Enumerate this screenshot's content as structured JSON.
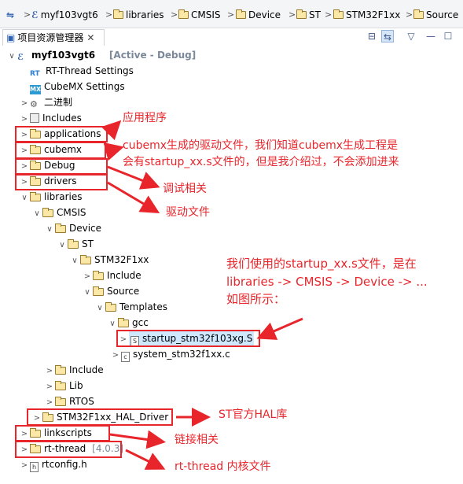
{
  "breadcrumb": [
    "myf103vgt6",
    "libraries",
    "CMSIS",
    "Device",
    "ST",
    "STM32F1xx",
    "Source"
  ],
  "view": {
    "tab_label": "项目资源管理器",
    "close_glyph": "✕"
  },
  "toolbar": {
    "collapse": "⊟",
    "link": "⇆",
    "menu": "▽",
    "minimize": "—",
    "maximize": "☐"
  },
  "tree": {
    "project": "myf103vgt6",
    "project_status": "[Active - Debug]",
    "rt_settings": "RT-Thread Settings",
    "cubemx_settings": "CubeMX Settings",
    "binaries": "二进制",
    "includes": "Includes",
    "applications": "applications",
    "cubemx": "cubemx",
    "debug": "Debug",
    "drivers": "drivers",
    "libraries": "libraries",
    "cmsis": "CMSIS",
    "device": "Device",
    "st": "ST",
    "stm32f1xx": "STM32F1xx",
    "include": "Include",
    "source": "Source",
    "templates": "Templates",
    "gcc": "gcc",
    "startup_file": "startup_stm32f103xg.S",
    "system_file": "system_stm32f1xx.c",
    "cmsis_include": "Include",
    "cmsis_lib": "Lib",
    "cmsis_rtos": "RTOS",
    "hal_driver": "STM32F1xx_HAL_Driver",
    "linkscripts": "linkscripts",
    "rt_thread": "rt-thread",
    "rt_thread_version": "[4.0.3]",
    "rtconfig": "rtconfig.h"
  },
  "annotations": {
    "app": "应用程序",
    "cubemx_line1": "cubemx生成的驱动文件，我们知道cubemx生成工程是",
    "cubemx_line2": "会有startup_xx.s文件的，但是我介绍过，不会添加进来",
    "debug": "调试相关",
    "drivers": "驱动文件",
    "startup_line1": "我们使用的startup_xx.s文件，是在",
    "startup_line2": "libraries -> CMSIS -> Device -> ...",
    "startup_line3": "如图所示：",
    "hal": "ST官方HAL库",
    "linkscripts": "链接相关",
    "rtthread": "rt-thread 内核文件"
  },
  "colors": {
    "annotation": "#e8252b",
    "selection": "#cde8ff",
    "status": "#7b8899"
  }
}
